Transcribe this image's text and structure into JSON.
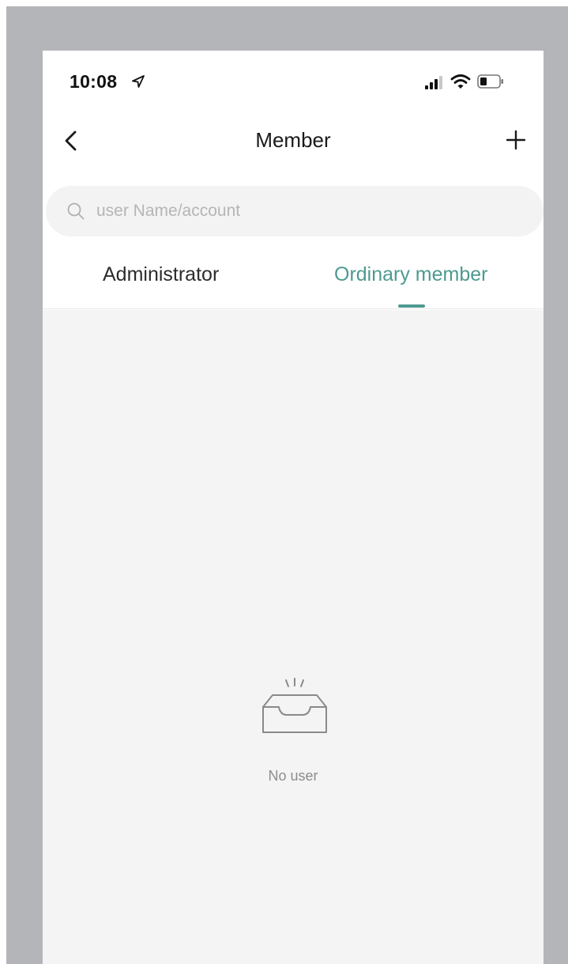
{
  "status_bar": {
    "time": "10:08",
    "icons": [
      "location-arrow-icon",
      "cellular-signal-icon",
      "wifi-icon",
      "battery-icon"
    ]
  },
  "nav": {
    "title": "Member",
    "back_icon": "chevron-left-icon",
    "add_icon": "plus-icon"
  },
  "search": {
    "placeholder": "user Name/account",
    "value": "",
    "icon": "search-icon"
  },
  "tabs": [
    {
      "label": "Administrator",
      "active": false
    },
    {
      "label": "Ordinary member",
      "active": true
    }
  ],
  "empty_state": {
    "icon": "empty-inbox-icon",
    "message": "No user"
  },
  "colors": {
    "accent": "#4d9a90",
    "bezel": "#b4b5b8",
    "content_bg": "#f4f4f4",
    "search_bg": "#f3f3f3"
  }
}
